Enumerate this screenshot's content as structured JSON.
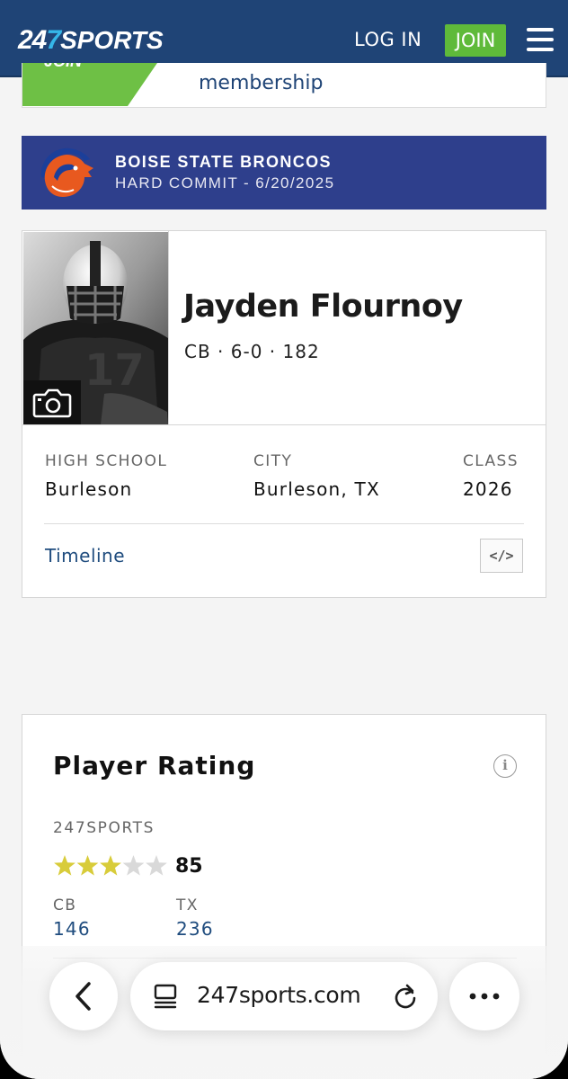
{
  "header": {
    "logo": {
      "part1": "24",
      "part2": "7",
      "part3": "SPORTS"
    },
    "login_label": "LOG IN",
    "join_label": "JOIN",
    "menu_icon": "hamburger-menu-icon"
  },
  "promo": {
    "tag_text": "JOIN",
    "text": "membership"
  },
  "commit": {
    "team": "BOISE STATE BRONCOS",
    "status": "HARD COMMIT - 6/20/2025",
    "logo_icon": "bronco-head-logo-icon",
    "colors": {
      "banner": "#2e3f8c",
      "logo_orange": "#e8591f",
      "logo_blue": "#1b3f9a"
    }
  },
  "player": {
    "name": "Jayden Flournoy",
    "metrics": "CB · 6-0 · 182",
    "photo_icon": "camera-icon",
    "facts": [
      {
        "label": "HIGH SCHOOL",
        "value": "Burleson"
      },
      {
        "label": "CITY",
        "value": "Burleson, TX"
      },
      {
        "label": "CLASS",
        "value": "2026"
      }
    ],
    "timeline_label": "Timeline",
    "embed_label": "</>"
  },
  "rating": {
    "title": "Player Rating",
    "info_label": "i",
    "source": "247SPORTS",
    "stars_filled": 3,
    "stars_total": 5,
    "value": "85",
    "ranks": [
      {
        "label": "CB",
        "value": "146"
      },
      {
        "label": "TX",
        "value": "236"
      }
    ],
    "colors": {
      "star_on": "#d8cc3a",
      "star_off": "#d9d9d9"
    }
  },
  "browser": {
    "url": "247sports.com",
    "back_icon": "chevron-left-icon",
    "tabs_icon": "tabs-icon",
    "reload_icon": "reload-icon",
    "more_icon": "more-dots-icon"
  },
  "colors": {
    "header_bg": "#1f4476",
    "join_bg": "#5fba3a",
    "link": "#1f4c7e"
  }
}
